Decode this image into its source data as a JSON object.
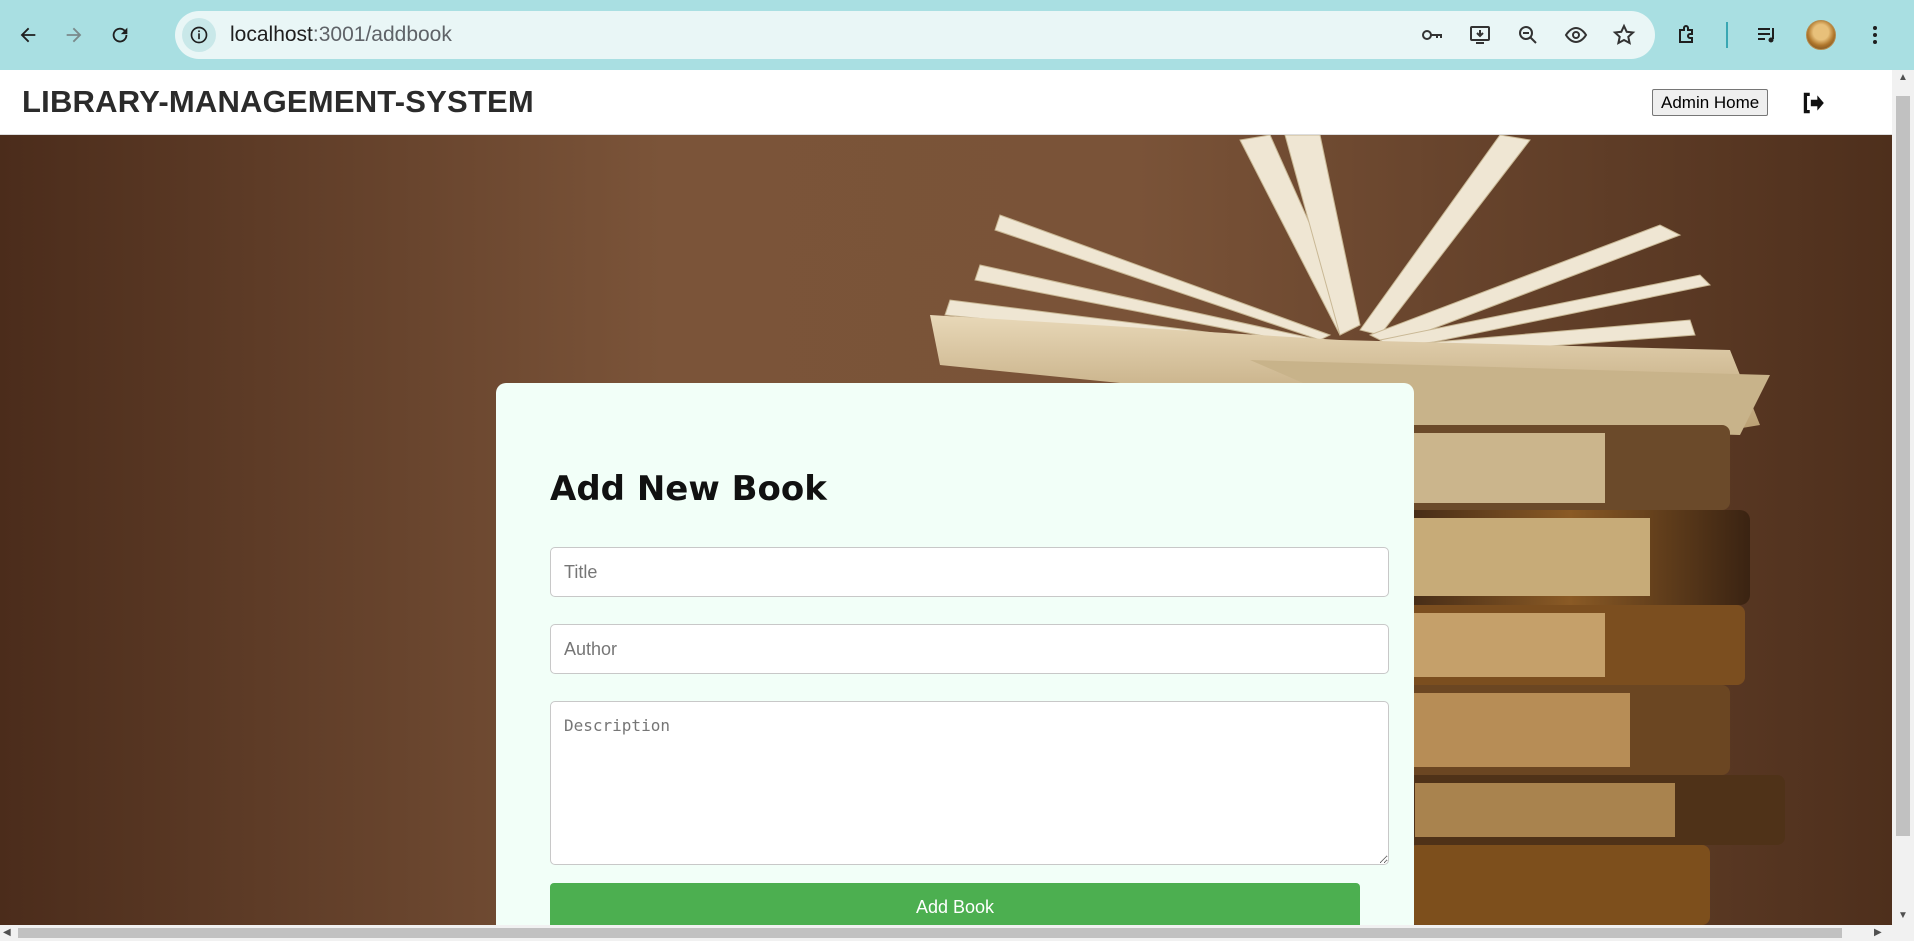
{
  "browser": {
    "url_host": "localhost",
    "url_path": ":3001/addbook",
    "accent_color": "#a9dfe2"
  },
  "navbar": {
    "brand": "LIBRARY-MANAGEMENT-SYSTEM",
    "admin_home_label": "Admin Home",
    "logout_icon": "sign-out-icon"
  },
  "form": {
    "heading": "Add New Book",
    "title_placeholder": "Title",
    "author_placeholder": "Author",
    "description_placeholder": "Description",
    "submit_label": "Add Book",
    "submit_color": "#4caf50",
    "card_color": "#f2fff8"
  }
}
